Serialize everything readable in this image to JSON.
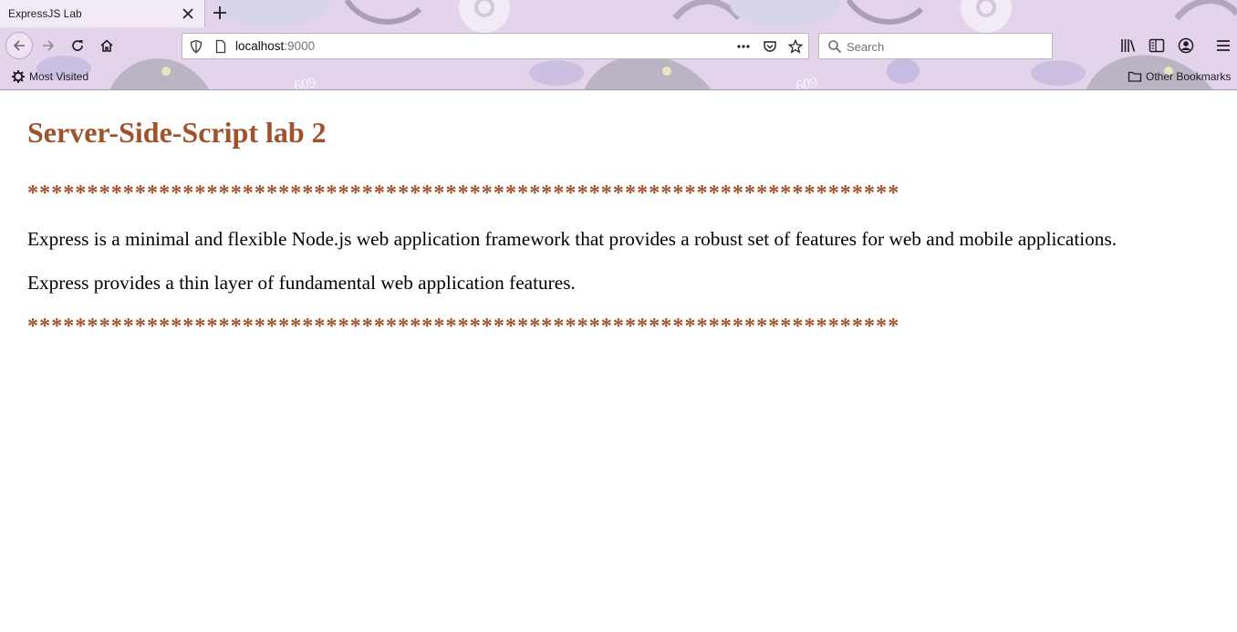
{
  "browser": {
    "tab": {
      "title": "ExpressJS Lab"
    },
    "url": {
      "host": "localhost",
      "port": ":9000"
    },
    "search": {
      "placeholder": "Search"
    },
    "bookmarks": {
      "most_visited": "Most Visited",
      "other": "Other Bookmarks"
    },
    "theme_numbers": [
      "609",
      "609"
    ],
    "icons": {
      "close": "close-icon",
      "new_tab": "plus-icon",
      "back": "arrow-left-icon",
      "forward": "arrow-right-icon",
      "reload": "reload-icon",
      "home": "home-icon",
      "shield": "shield-icon",
      "page": "page-icon",
      "more": "more-icon",
      "pocket": "pocket-icon",
      "star": "star-icon",
      "search": "search-icon",
      "library": "library-icon",
      "sidebar": "sidebar-icon",
      "account": "account-icon",
      "menu": "hamburger-menu-icon",
      "gear": "gear-icon",
      "folder": "folder-icon"
    }
  },
  "page": {
    "heading": "Server-Side-Script lab 2",
    "separator": "*************************************************************************",
    "paragraphs": [
      "Express is a minimal and flexible Node.js web application framework that provides a robust set of features for web and mobile applications.",
      "Express provides a thin layer of fundamental web application features."
    ]
  },
  "colors": {
    "heading": "#a0522d",
    "chrome_bg": "#e3d4ec",
    "text": "#000000"
  }
}
